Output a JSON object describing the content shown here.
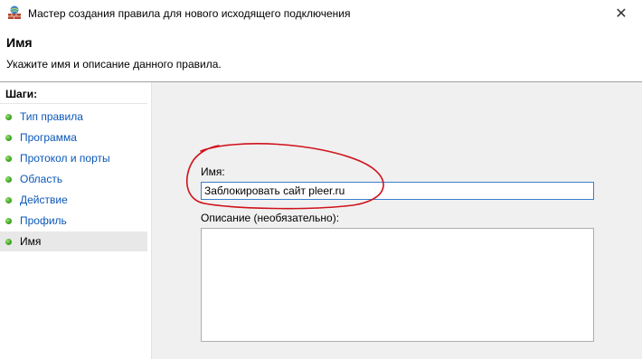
{
  "window": {
    "title": "Мастер создания правила для нового исходящего подключения",
    "close_glyph": "✕"
  },
  "header": {
    "title": "Имя",
    "description": "Укажите имя и описание данного правила."
  },
  "steps": {
    "title": "Шаги:",
    "items": [
      {
        "label": "Тип правила",
        "active": false
      },
      {
        "label": "Программа",
        "active": false
      },
      {
        "label": "Протокол и порты",
        "active": false
      },
      {
        "label": "Область",
        "active": false
      },
      {
        "label": "Действие",
        "active": false
      },
      {
        "label": "Профиль",
        "active": false
      },
      {
        "label": "Имя",
        "active": true
      }
    ]
  },
  "form": {
    "name_label": "Имя:",
    "name_value": "Заблокировать сайт pleer.ru",
    "description_label": "Описание (необязательно):",
    "description_value": ""
  },
  "colors": {
    "step_link": "#0a57b8",
    "step_dot": "#3aa51b",
    "annotation": "#d0121b",
    "content_bg": "#f0f0f0"
  },
  "icons": {
    "app": "firewall-icon",
    "close": "close-icon",
    "step": "green-dot-icon"
  }
}
